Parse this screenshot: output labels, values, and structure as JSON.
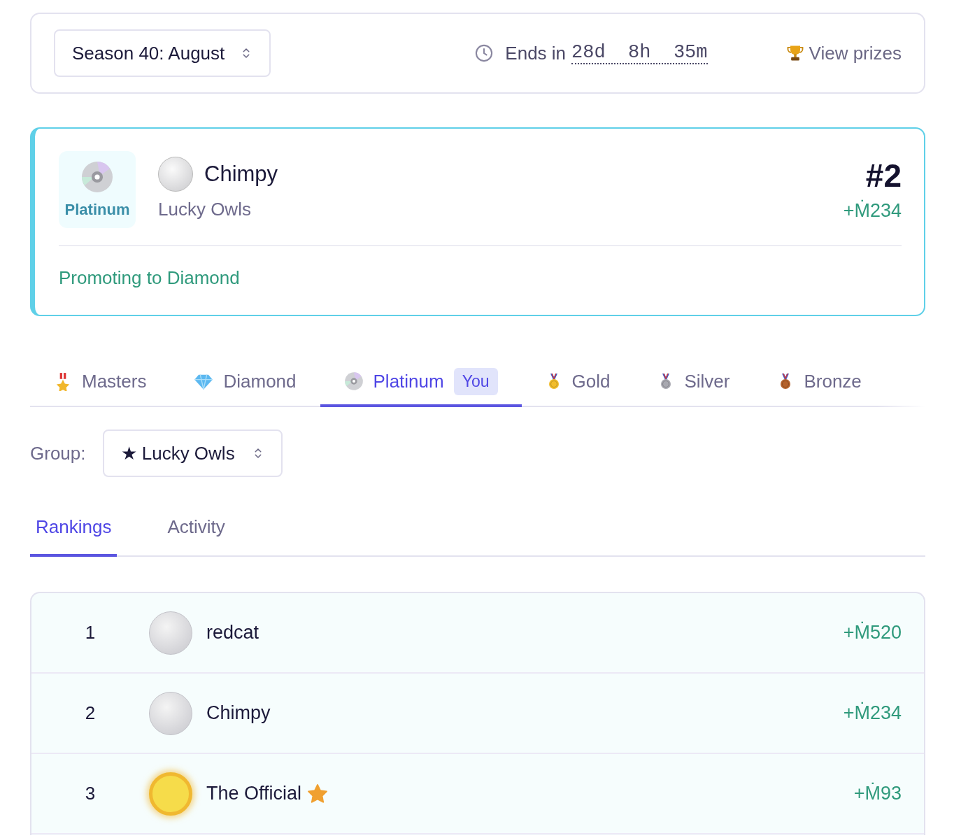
{
  "season_select": {
    "value": "Season 40: August"
  },
  "timer": {
    "label": "Ends in",
    "remaining": "28d  8h  35m"
  },
  "prizes_link": {
    "label": "View prizes"
  },
  "player_card": {
    "league": "Platinum",
    "name": "Chimpy",
    "group": "Lucky Owls",
    "rank": "#2",
    "amount": "+Ṁ234",
    "status": "Promoting to Diamond"
  },
  "league_tabs": [
    {
      "kind": "masters",
      "label": "Masters",
      "selected": false
    },
    {
      "kind": "diamond",
      "label": "Diamond",
      "selected": false
    },
    {
      "kind": "platinum",
      "label": "Platinum",
      "selected": true,
      "badge": "You"
    },
    {
      "kind": "gold",
      "label": "Gold",
      "selected": false
    },
    {
      "kind": "silver",
      "label": "Silver",
      "selected": false
    },
    {
      "kind": "bronze",
      "label": "Bronze",
      "selected": false
    }
  ],
  "group_select": {
    "label": "Group:",
    "value": "★ Lucky Owls"
  },
  "view_tabs": [
    {
      "label": "Rankings",
      "selected": true
    },
    {
      "label": "Activity",
      "selected": false
    }
  ],
  "rankings": [
    {
      "rank": "1",
      "name": "redcat",
      "amount": "+Ṁ520",
      "featured": false
    },
    {
      "rank": "2",
      "name": "Chimpy",
      "amount": "+Ṁ234",
      "featured": false
    },
    {
      "rank": "3",
      "name": "The Official",
      "amount": "+Ṁ93",
      "featured": true
    }
  ]
}
